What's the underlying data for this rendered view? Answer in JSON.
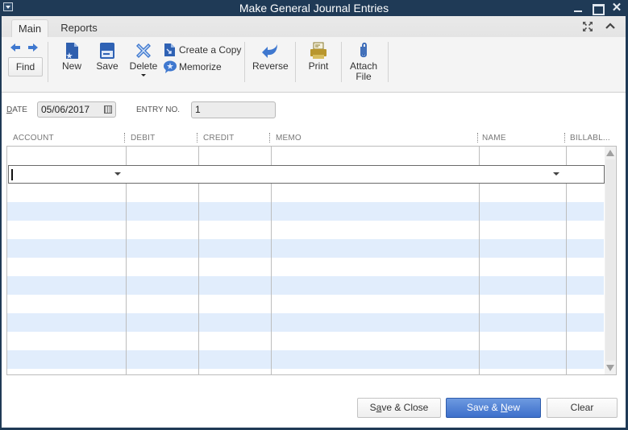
{
  "window": {
    "title": "Make General Journal Entries"
  },
  "tabs": [
    {
      "label": "Main",
      "active": true
    },
    {
      "label": "Reports",
      "active": false
    }
  ],
  "toolbar": {
    "find": "Find",
    "new": "New",
    "save": "Save",
    "delete": "Delete",
    "create_copy": "Create a Copy",
    "memorize": "Memorize",
    "reverse": "Reverse",
    "print": "Print",
    "attach_line1": "Attach",
    "attach_line2": "File"
  },
  "form": {
    "date_label_u": "D",
    "date_label_rest": "ATE",
    "date_value": "05/06/2017",
    "entry_no_label": "ENTRY NO.",
    "entry_no_value": "1"
  },
  "grid": {
    "columns": [
      "ACCOUNT",
      "DEBIT",
      "CREDIT",
      "MEMO",
      "NAME",
      "BILLABL..."
    ],
    "rows": []
  },
  "buttons": {
    "save_close_pre": "S",
    "save_close_u": "a",
    "save_close_post": "ve & Close",
    "save_new_pre": "Save & ",
    "save_new_u": "N",
    "save_new_post": "ew",
    "clear": "Clear"
  },
  "colors": {
    "titlebar": "#1f3a56",
    "row_alt": "#e1edfc",
    "primary_button": "#3d6fcb"
  }
}
